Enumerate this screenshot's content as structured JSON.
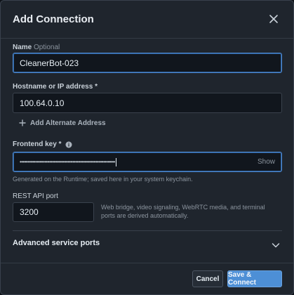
{
  "dialog": {
    "title": "Add Connection",
    "close_icon": "close-icon"
  },
  "fields": {
    "name": {
      "label": "Name",
      "optional": "Optional",
      "value": "CleanerBot-023"
    },
    "hostname": {
      "label": "Hostname or IP address *",
      "value": "100.64.0.10"
    },
    "add_alternate": {
      "icon": "plus-icon",
      "label": "Add Alternate Address"
    },
    "frontend_key": {
      "label": "Frontend key *",
      "info_icon": "info-icon",
      "masked_value": "••••••••••••••••••••••••••••••••••••••••••••••••••••••••••••••",
      "show_label": "Show",
      "hint": "Generated on the Runtime; saved here in your system keychain."
    },
    "rest_port": {
      "label": "REST API port",
      "value": "3200",
      "help": "Web bridge, video signaling, WebRTC media, and terminal ports are derived automatically."
    }
  },
  "advanced": {
    "label": "Advanced service ports",
    "icon": "chevron-down-icon"
  },
  "footer": {
    "cancel_label": "Cancel",
    "submit_label": "Save & Connect"
  },
  "colors": {
    "accent": "#4d8fd6",
    "background": "#1f252d",
    "input_bg": "#11161d"
  }
}
